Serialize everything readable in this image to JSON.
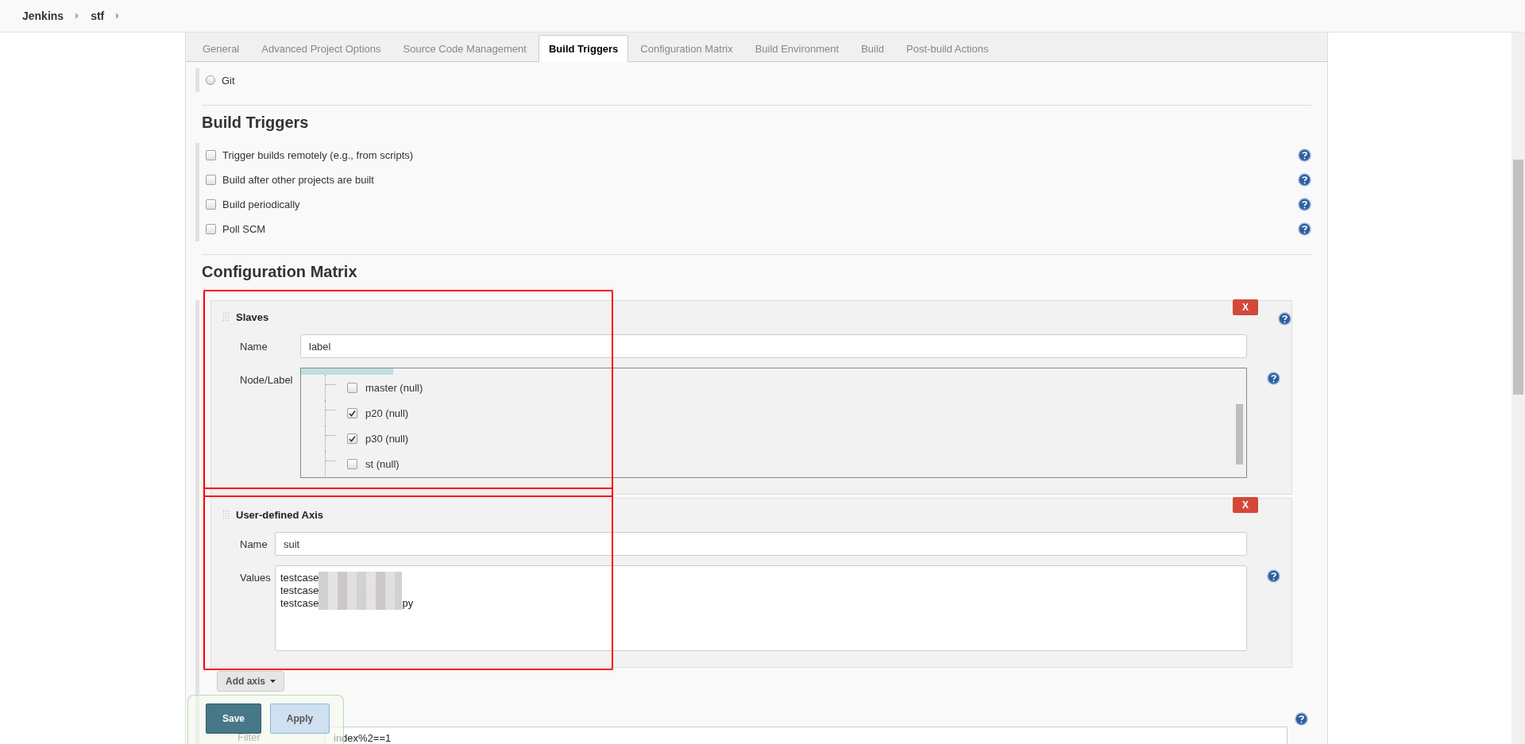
{
  "breadcrumbs": [
    {
      "label": "Jenkins"
    },
    {
      "label": "stf"
    }
  ],
  "tabs": [
    {
      "label": "General",
      "selected": false
    },
    {
      "label": "Advanced Project Options",
      "selected": false
    },
    {
      "label": "Source Code Management",
      "selected": false
    },
    {
      "label": "Build Triggers",
      "selected": true
    },
    {
      "label": "Configuration Matrix",
      "selected": false
    },
    {
      "label": "Build Environment",
      "selected": false
    },
    {
      "label": "Build",
      "selected": false
    },
    {
      "label": "Post-build Actions",
      "selected": false
    }
  ],
  "scm": {
    "options": [
      {
        "label": "Git",
        "selected": false
      }
    ]
  },
  "build_triggers": {
    "title": "Build Triggers",
    "options": [
      {
        "label": "Trigger builds remotely (e.g., from scripts)",
        "checked": false
      },
      {
        "label": "Build after other projects are built",
        "checked": false
      },
      {
        "label": "Build periodically",
        "checked": false
      },
      {
        "label": "Poll SCM",
        "checked": false
      }
    ]
  },
  "configuration_matrix": {
    "title": "Configuration Matrix",
    "axes": [
      {
        "kind": "slaves",
        "title": "Slaves",
        "highlighted": true,
        "delete_label": "X",
        "name_label": "Name",
        "name_value": "label",
        "list_label": "Node/Label",
        "nodes": [
          {
            "label": "master (null)",
            "checked": false
          },
          {
            "label": "p20 (null)",
            "checked": true
          },
          {
            "label": "p30 (null)",
            "checked": true
          },
          {
            "label": "st (null)",
            "checked": false
          }
        ]
      },
      {
        "kind": "user",
        "title": "User-defined Axis",
        "highlighted": true,
        "delete_label": "X",
        "name_label": "Name",
        "name_value": "suit",
        "values_label": "Values",
        "values": [
          {
            "text": "testcase",
            "redacted": true
          },
          {
            "text": "testcase",
            "redacted": true
          },
          {
            "text": "testcase",
            "redacted": true,
            "after": "py"
          }
        ]
      }
    ],
    "add_axis_button": "Add axis",
    "filter": {
      "label": "Filter",
      "value": "index%2==1"
    }
  },
  "save_bar": {
    "buttons": [
      {
        "label": "Save",
        "kind": "primary"
      },
      {
        "label": "Apply",
        "kind": "secondary"
      }
    ]
  }
}
